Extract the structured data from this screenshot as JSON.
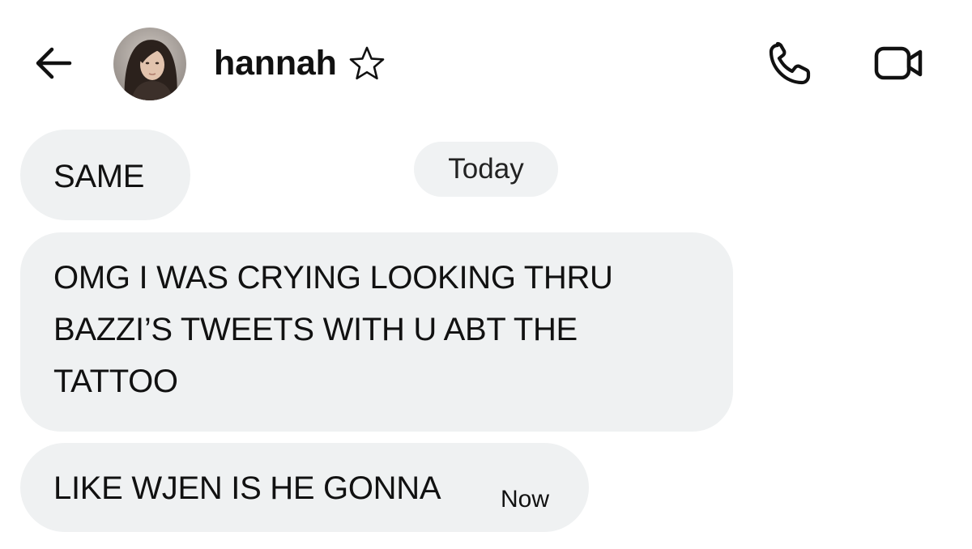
{
  "header": {
    "back_icon": "arrow-left-icon",
    "contact_name": "hannah",
    "star_icon": "star-outline-icon",
    "call_icon": "phone-icon",
    "video_icon": "video-camera-icon"
  },
  "date_separator": "Today",
  "messages": [
    {
      "text": "SAME"
    },
    {
      "text": "OMG I WAS CRYING LOOKING THRU\nBAZZI’S TWEETS WITH U ABT THE\nTATTOO"
    },
    {
      "text": "LIKE WJEN IS HE GONNA",
      "time": "Now"
    }
  ],
  "colors": {
    "bubble_background": "#eff1f2",
    "text": "#111111",
    "page_background": "#ffffff"
  }
}
